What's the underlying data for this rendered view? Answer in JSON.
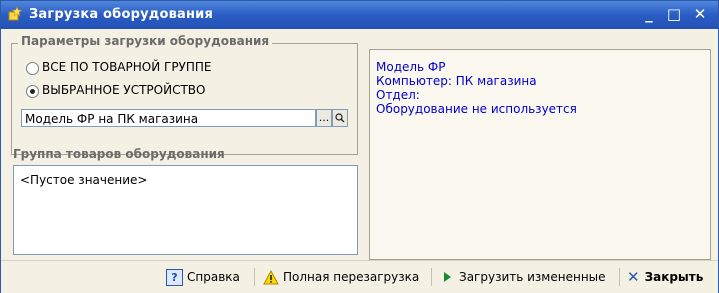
{
  "window": {
    "title": "Загрузка оборудования",
    "minimize": "_",
    "maximize": "□",
    "close": "✕"
  },
  "params": {
    "group_title": "Параметры загрузки оборудования",
    "radio_all_label": "ВСЕ ПО ТОВАРНОЙ ГРУППЕ",
    "radio_selected_label": "ВЫБРАННОЕ УСТРОЙСТВО",
    "selected_option": "ВЫБРАННОЕ УСТРОЙСТВО",
    "device_value": "Модель ФР на ПК магазина",
    "select_btn": "...",
    "search_btn": "Q"
  },
  "goods_group": {
    "title": "Группа товаров оборудования",
    "value": "<Пустое значение>"
  },
  "info": {
    "lines": [
      "Модель ФР",
      "Компьютер: ПК магазина",
      "Отдел:",
      "Оборудование не используется"
    ],
    "text_color": "#0000cc"
  },
  "toolbar": {
    "help_icon": "?",
    "help_label": "Справка",
    "full_reload_label": "Полная перезагрузка",
    "load_changed_label": "Загрузить измененные",
    "close_label": "Закрыть"
  }
}
